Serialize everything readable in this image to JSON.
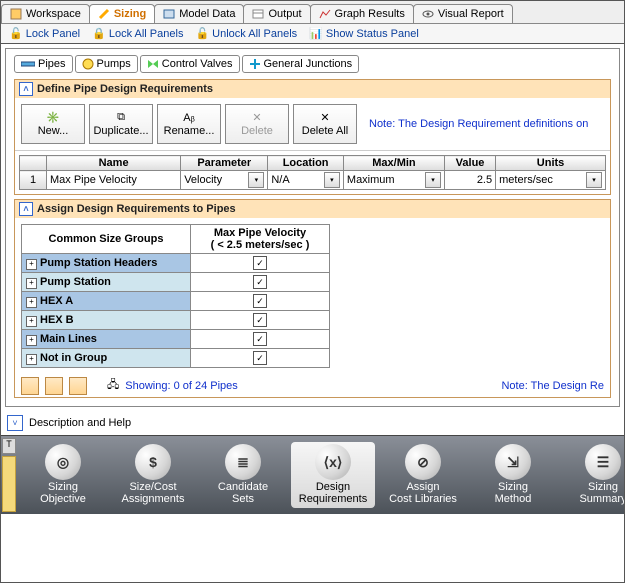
{
  "topTabs": [
    {
      "label": "Workspace",
      "icon": "workspace"
    },
    {
      "label": "Sizing",
      "icon": "sizing",
      "active": true
    },
    {
      "label": "Model Data",
      "icon": "model-data"
    },
    {
      "label": "Output",
      "icon": "output"
    },
    {
      "label": "Graph Results",
      "icon": "graph"
    },
    {
      "label": "Visual Report",
      "icon": "visual"
    }
  ],
  "toolbar": [
    {
      "label": "Lock Panel",
      "icon": "lock"
    },
    {
      "label": "Lock All Panels",
      "icon": "lock-all"
    },
    {
      "label": "Unlock All Panels",
      "icon": "unlock"
    },
    {
      "label": "Show Status Panel",
      "icon": "status"
    }
  ],
  "subTabs": [
    {
      "label": "Pipes",
      "icon": "pipe",
      "active": true
    },
    {
      "label": "Pumps",
      "icon": "pump"
    },
    {
      "label": "Control Valves",
      "icon": "valve"
    },
    {
      "label": "General Junctions",
      "icon": "junction"
    }
  ],
  "defineSection": {
    "title": "Define Pipe Design Requirements",
    "buttons": [
      {
        "label": "New...",
        "icon": "new"
      },
      {
        "label": "Duplicate...",
        "icon": "dup"
      },
      {
        "label": "Rename...",
        "icon": "ren"
      },
      {
        "label": "Delete",
        "icon": "del",
        "disabled": true
      },
      {
        "label": "Delete All",
        "icon": "delall"
      }
    ],
    "note": "Note: The Design Requirement definitions on",
    "grid": {
      "headers": [
        "",
        "Name",
        "Parameter",
        "Location",
        "Max/Min",
        "Value",
        "Units"
      ],
      "row": {
        "n": "1",
        "name": "Max Pipe Velocity",
        "parameter": "Velocity",
        "location": "N/A",
        "maxmin": "Maximum",
        "value": "2.5",
        "units": "meters/sec"
      }
    }
  },
  "assignSection": {
    "title": "Assign Design Requirements to Pipes",
    "colGroup": "Common Size Groups",
    "colReq": "Max Pipe Velocity\n( < 2.5 meters/sec )",
    "rows": [
      {
        "name": "Pump Station Headers",
        "checked": true
      },
      {
        "name": "Pump Station",
        "checked": true
      },
      {
        "name": "HEX A",
        "checked": true
      },
      {
        "name": "HEX B",
        "checked": true
      },
      {
        "name": "Main Lines",
        "checked": true
      },
      {
        "name": "Not in Group",
        "checked": true
      }
    ],
    "showing": "Showing: 0 of 24 Pipes",
    "noteRight": "Note: The Design Re"
  },
  "descBar": "Description and Help",
  "bottomNav": [
    {
      "label": "Sizing\nObjective",
      "glyph": "◎"
    },
    {
      "label": "Size/Cost\nAssignments",
      "glyph": "$"
    },
    {
      "label": "Candidate\nSets",
      "glyph": "≣"
    },
    {
      "label": "Design\nRequirements",
      "glyph": "⟨x⟩",
      "active": true
    },
    {
      "label": "Assign\nCost Libraries",
      "glyph": "⊘"
    },
    {
      "label": "Sizing\nMethod",
      "glyph": "⇲"
    },
    {
      "label": "Sizing\nSummary",
      "glyph": "☰"
    }
  ]
}
